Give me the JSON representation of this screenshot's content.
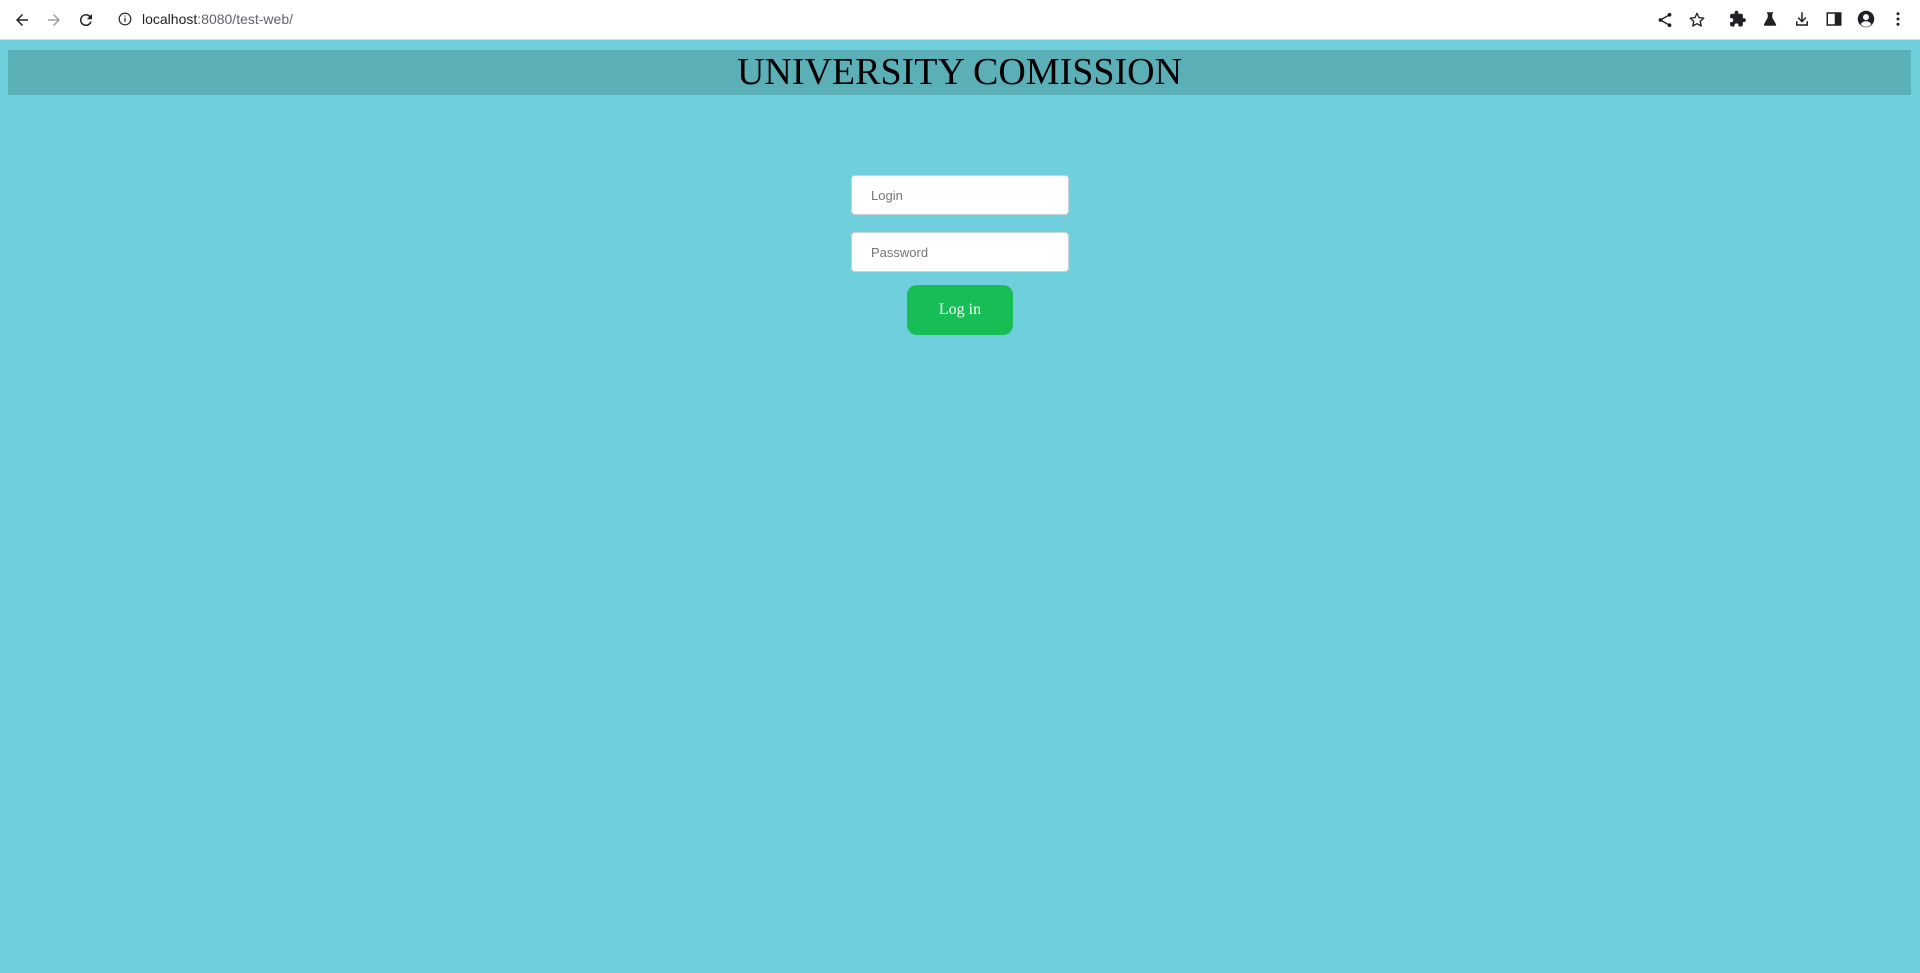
{
  "browser": {
    "url_host": "localhost",
    "url_rest": ":8080/test-web/",
    "icons": [
      "back-icon",
      "forward-icon",
      "reload-icon",
      "info-icon",
      "share-icon",
      "bookmark-star-icon",
      "extensions-icon",
      "labs-icon",
      "download-icon",
      "sidepanel-icon",
      "profile-icon",
      "menu-icon"
    ]
  },
  "page": {
    "title": "UNIVERSITY COMISSION",
    "login_placeholder": "Login",
    "password_placeholder": "Password",
    "login_button": "Log in"
  },
  "colors": {
    "background": "#6fcfdc",
    "header": "#5bb0b8",
    "button": "#16be55"
  }
}
